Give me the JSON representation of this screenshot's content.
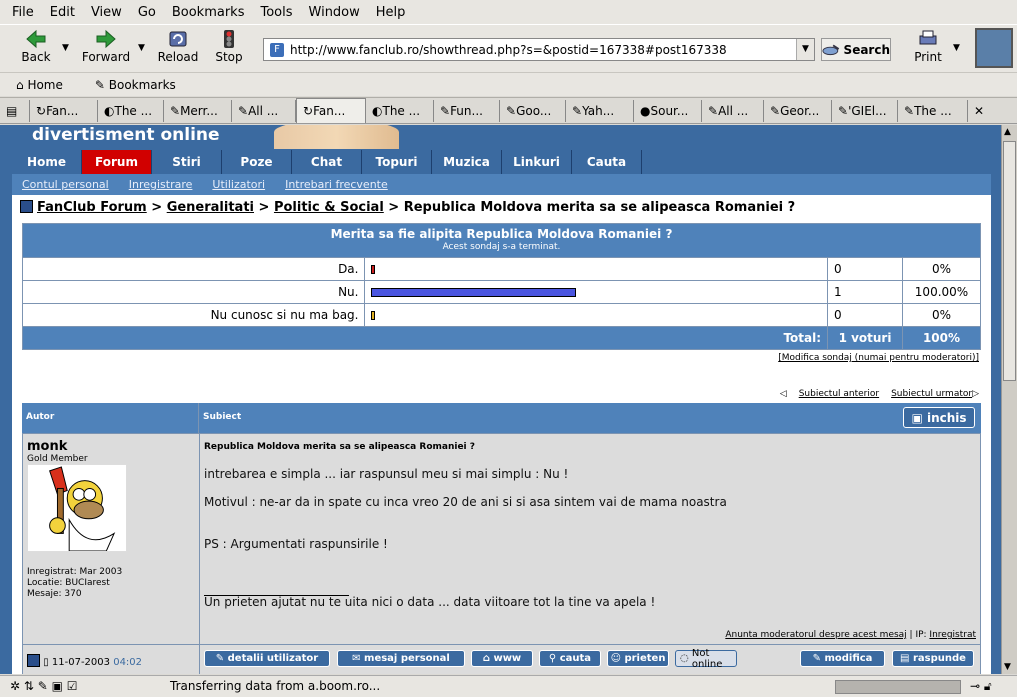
{
  "menu": [
    "File",
    "Edit",
    "View",
    "Go",
    "Bookmarks",
    "Tools",
    "Window",
    "Help"
  ],
  "nav": {
    "back": "Back",
    "forward": "Forward",
    "reload": "Reload",
    "stop": "Stop",
    "print": "Print",
    "search": "Search"
  },
  "url": "http://www.fanclub.ro/showthread.php?s=&postid=167338#post167338",
  "bookmarks": {
    "home": "Home",
    "bookmarks": "Bookmarks"
  },
  "tabs": [
    "Fan...",
    "The ...",
    "Merr...",
    "All ...",
    "Fan...",
    "The ...",
    "Fun...",
    "Goo...",
    "Yah...",
    "Sour...",
    "All ...",
    "Geor...",
    "'GIEl...",
    "The ..."
  ],
  "site": {
    "title": "divertisment online",
    "menu": [
      "Home",
      "Forum",
      "Stiri",
      "Poze",
      "Chat",
      "Topuri",
      "Muzica",
      "Linkuri",
      "Cauta"
    ],
    "active_menu": "Forum",
    "submenu": [
      "Contul personal",
      "Inregistrare",
      "Utilizatori",
      "Intrebari frecvente"
    ]
  },
  "breadcrumb": {
    "root": "FanClub Forum",
    "sep1": " > ",
    "cat": "Generalitati",
    "sep2": " > ",
    "sub": "Politic & Social",
    "sep3": " > ",
    "topic": "Republica Moldova merita sa se alipeasca Romaniei ?"
  },
  "poll": {
    "question": "Merita sa fie alipita Republica Moldova Romaniei ?",
    "closed": "Acest sondaj s-a terminat.",
    "options": [
      {
        "label": "Da.",
        "votes": "0",
        "percent": "0%",
        "fraction": 0.0,
        "color": "#cc2020"
      },
      {
        "label": "Nu.",
        "votes": "1",
        "percent": "100.00%",
        "fraction": 1.0,
        "color": "#4a55e0"
      },
      {
        "label": "Nu cunosc si nu ma bag.",
        "votes": "0",
        "percent": "0%",
        "fraction": 0.0,
        "color": "#e0b020"
      }
    ],
    "total_label": "Total:",
    "total_votes": "1 voturi",
    "total_percent": "100%",
    "mod_link": "[Modifica sondaj (numai pentru moderatori)]"
  },
  "thread_nav": {
    "prev": "Subiectul anterior",
    "next": "Subiectul urmator"
  },
  "post_header": {
    "author": "Autor",
    "subject": "Subiect",
    "close": "inchis"
  },
  "post": {
    "username": "monk",
    "rank": "Gold Member",
    "registered": "Inregistrat: Mar 2003",
    "location": "Locatie: BUCIarest",
    "messages": "Mesaje: 370",
    "title": "Republica Moldova merita sa se alipeasca Romaniei ?",
    "lines": [
      "intrebarea e simpla ... iar raspunsul meu si mai simplu : Nu !",
      "Motivul : ne-ar da in spate cu inca vreo 20 de ani si si asa sintem vai de mama noastra",
      "PS : Argumentati raspunsirile !",
      "Un prieten ajutat nu te uita nici o data ... data viitoare tot la tine va apela !"
    ],
    "report": "Anunta moderatorul despre acest mesaj",
    "ip_label": " | IP: ",
    "ip": "Inregistrat",
    "date": "11-07-2003",
    "time": "04:02"
  },
  "post_buttons": [
    "detalii utilizator",
    "mesaj personal",
    "www",
    "cauta",
    "prieten",
    "Not online",
    "modifica",
    "raspunde"
  ],
  "status": "Transferring data from a.boom.ro..."
}
